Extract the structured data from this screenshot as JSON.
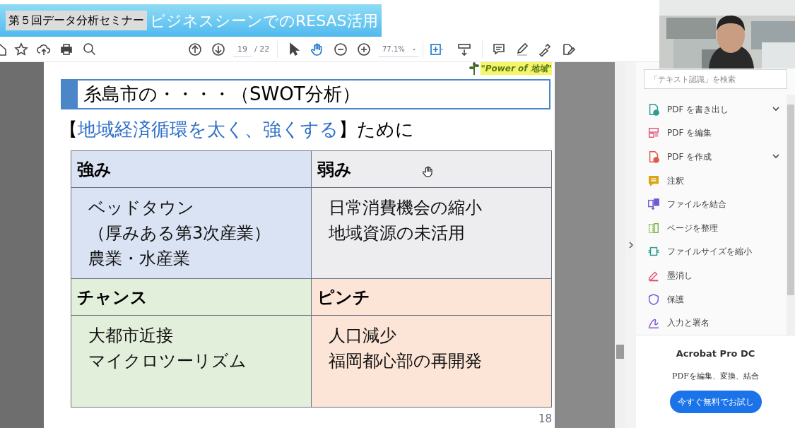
{
  "banner": {
    "series": "第５回データ分析セミナー",
    "title": "ビジネスシーンでのRESAS活用"
  },
  "toolbar": {
    "page": "19",
    "page_total": "/ 22",
    "zoom": "77.1%"
  },
  "slide": {
    "tagline": "\"Power of 地域\"",
    "title": "糸島市の・・・・（SWOT分析）",
    "subtitle": [
      {
        "text": "【",
        "highlight": false
      },
      {
        "text": "地域経済循環を太く、強くする",
        "highlight": true
      },
      {
        "text": "】ために",
        "highlight": false
      }
    ],
    "quadrants": [
      {
        "heading": "強み",
        "color": "#dae3f3",
        "items": [
          "ベッドタウン",
          "（厚みある第3次産業）",
          "農業・水産業"
        ]
      },
      {
        "heading": "弱み",
        "color": "#ededf0",
        "items": [
          "日常消費機会の縮小",
          "地域資源の未活用"
        ]
      },
      {
        "heading": "チャンス",
        "color": "#e2efda",
        "items": [
          "大都市近接",
          "マイクロツーリズム"
        ]
      },
      {
        "heading": "ピンチ",
        "color": "#fce4d6",
        "items": [
          "人口減少",
          "福岡都心部の再開発"
        ]
      }
    ],
    "page_number": "18"
  },
  "tools_panel": {
    "search": {
      "placeholder": "「テキスト認識」を検索"
    },
    "tools": [
      {
        "label": "PDF を書き出し",
        "kind": "export",
        "dropdown": true
      },
      {
        "label": "PDF を編集",
        "kind": "edit",
        "dropdown": false
      },
      {
        "label": "PDF を作成",
        "kind": "create",
        "dropdown": true
      },
      {
        "label": "注釈",
        "kind": "comment",
        "dropdown": false
      },
      {
        "label": "ファイルを結合",
        "kind": "combine",
        "dropdown": false
      },
      {
        "label": "ページを整理",
        "kind": "organize",
        "dropdown": false
      },
      {
        "label": "ファイルサイズを縮小",
        "kind": "compress",
        "dropdown": false
      },
      {
        "label": "墨消し",
        "kind": "redact",
        "dropdown": false
      },
      {
        "label": "保護",
        "kind": "protect",
        "dropdown": false
      },
      {
        "label": "入力と署名",
        "kind": "sign",
        "dropdown": false
      }
    ],
    "promo": {
      "title": "Acrobat Pro DC",
      "subtitle": "PDFを編集、変換、結合",
      "button": "今すぐ無料でお試し"
    }
  }
}
